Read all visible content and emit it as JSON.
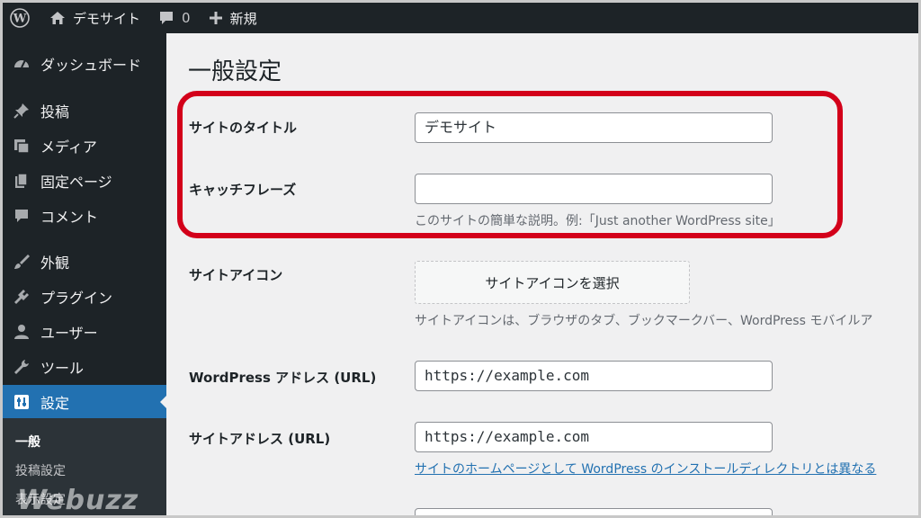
{
  "adminbar": {
    "site_name": "デモサイト",
    "comment_count": "0",
    "new_label": "新規"
  },
  "sidebar": {
    "items": [
      {
        "label": "ダッシュボード",
        "icon": "dashboard-icon"
      },
      {
        "label": "投稿",
        "icon": "pin-icon"
      },
      {
        "label": "メディア",
        "icon": "media-icon"
      },
      {
        "label": "固定ページ",
        "icon": "page-icon"
      },
      {
        "label": "コメント",
        "icon": "comment-icon"
      },
      {
        "label": "外観",
        "icon": "brush-icon"
      },
      {
        "label": "プラグイン",
        "icon": "plugin-icon"
      },
      {
        "label": "ユーザー",
        "icon": "user-icon"
      },
      {
        "label": "ツール",
        "icon": "wrench-icon"
      },
      {
        "label": "設定",
        "icon": "settings-icon"
      }
    ],
    "submenu": [
      "一般",
      "投稿設定",
      "表示設定"
    ],
    "watermark": "Webuzz"
  },
  "main": {
    "title": "一般設定",
    "site_title": {
      "label": "サイトのタイトル",
      "value": "デモサイト"
    },
    "tagline": {
      "label": "キャッチフレーズ",
      "value": "",
      "description": "このサイトの簡単な説明。例:「Just another WordPress site」"
    },
    "site_icon": {
      "label": "サイトアイコン",
      "button": "サイトアイコンを選択",
      "description": "サイトアイコンは、ブラウザのタブ、ブックマークバー、WordPress モバイルア"
    },
    "wp_address": {
      "label": "WordPress アドレス (URL)",
      "value": "https://example.com"
    },
    "site_address": {
      "label": "サイトアドレス (URL)",
      "value": "https://example.com",
      "link": "サイトのホームページとして WordPress のインストールディレクトリとは異なる"
    }
  },
  "colors": {
    "adminbar_bg": "#1d2327",
    "active_menu": "#2271b1",
    "highlight": "#d3001a"
  }
}
